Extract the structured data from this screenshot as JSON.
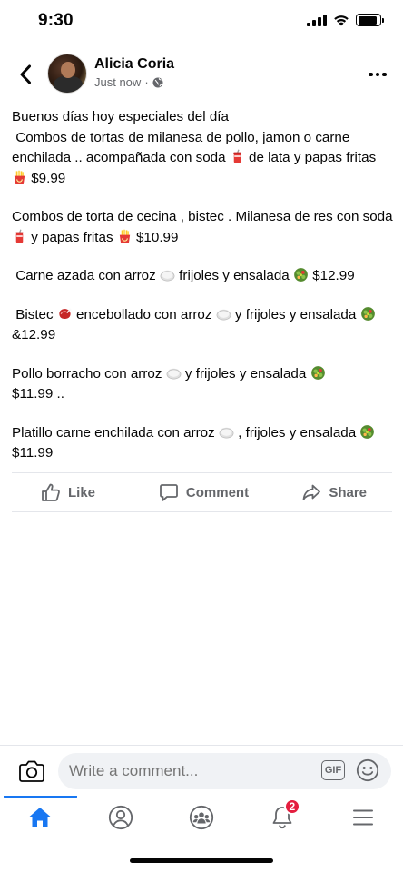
{
  "status_bar": {
    "time": "9:30"
  },
  "post": {
    "author": "Alicia Coria",
    "timestamp": "Just now",
    "meta_separator": "·",
    "privacy_icon": "globe-icon",
    "paragraphs": [
      {
        "segments": [
          {
            "text": "Buenos días hoy especiales del día\n Combos de tortas de milanesa de pollo, jamon o carne enchilada .. acompañada con soda "
          },
          {
            "emoji": "soda"
          },
          {
            "text": " de lata y papas fritas "
          },
          {
            "emoji": "fries"
          },
          {
            "text": " $9.99"
          }
        ]
      },
      {
        "segments": [
          {
            "text": "Combos de torta de cecina , bistec . Milanesa de res con soda "
          },
          {
            "emoji": "soda"
          },
          {
            "text": " y papas fritas "
          },
          {
            "emoji": "fries"
          },
          {
            "text": " $10.99"
          }
        ]
      },
      {
        "segments": [
          {
            "text": " Carne azada con arroz "
          },
          {
            "emoji": "rice-plate"
          },
          {
            "text": " frijoles y ensalada "
          },
          {
            "emoji": "salad"
          },
          {
            "text": " $12.99"
          }
        ]
      },
      {
        "segments": [
          {
            "text": " Bistec "
          },
          {
            "emoji": "steak"
          },
          {
            "text": " encebollado con arroz "
          },
          {
            "emoji": "rice-plate"
          },
          {
            "text": " y frijoles y ensalada "
          },
          {
            "emoji": "salad"
          },
          {
            "text": " &12.99"
          }
        ]
      },
      {
        "segments": [
          {
            "text": "Pollo borracho con arroz "
          },
          {
            "emoji": "rice-plate"
          },
          {
            "text": " y frijoles y ensalada "
          },
          {
            "emoji": "salad"
          },
          {
            "text": "\n$11.99 .."
          }
        ]
      },
      {
        "segments": [
          {
            "text": "Platillo carne enchilada con arroz "
          },
          {
            "emoji": "rice-plate"
          },
          {
            "text": " , frijoles y ensalada "
          },
          {
            "emoji": "salad"
          },
          {
            "text": "\n$11.99"
          }
        ]
      }
    ]
  },
  "actions": {
    "like_label": "Like",
    "comment_label": "Comment",
    "share_label": "Share"
  },
  "comment_bar": {
    "placeholder": "Write a comment...",
    "gif_label": "GIF"
  },
  "bottom_nav": {
    "items": [
      "home-icon",
      "profile-icon",
      "groups-icon",
      "notifications-icon",
      "menu-icon"
    ],
    "notifications_badge": "2",
    "active_color": "#1877f2"
  },
  "colors": {
    "secondary_text": "#65676b",
    "divider": "#e4e6eb",
    "input_bg": "#f0f2f5",
    "badge": "#e41e3f"
  }
}
